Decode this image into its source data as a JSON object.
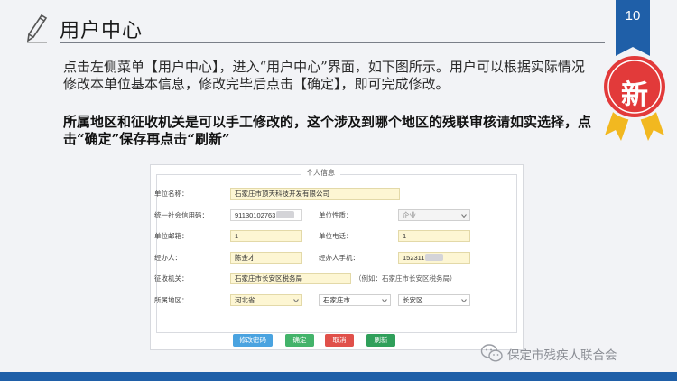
{
  "slide": {
    "title": "用户中心",
    "page_number": "10",
    "badge": "新"
  },
  "instructions": {
    "para1": "点击左侧菜单【用户中心】，进入“用户中心”界面，如下图所示。用户可以根据实际情况修改本单位基本信息，修改完毕后点击【确定】，即可完成修改。",
    "para2": "所属地区和征收机关是可以手工修改的，这个涉及到哪个地区的残联审核请如实选择，点击“确定”保存再点击“刷新”"
  },
  "form": {
    "legend": "个人信息",
    "fields": {
      "unit_name_label": "单位名称：",
      "unit_name_value": "石家庄市顶天科技开发有限公司",
      "credit_code_label": "统一社会信用码：",
      "credit_code_value": "91130102763",
      "unit_nature_label": "单位性质：",
      "unit_nature_value": "企业",
      "postcode_label": "单位邮箱：",
      "postcode_value": "1",
      "unit_phone_label": "单位电话：",
      "unit_phone_value": "1",
      "handler_label": "经办人：",
      "handler_value": "陈金才",
      "handler_mobile_label": "经办人手机：",
      "handler_mobile_value": "152311",
      "tax_office_label": "征收机关：",
      "tax_office_value": "石家庄市长安区税务局",
      "tax_office_hint": "（例如：石家庄市长安区税务局）",
      "region_label": "所属地区：",
      "province_value": "河北省",
      "city_value": "石家庄市",
      "district_value": "长安区"
    },
    "buttons": {
      "change_password": "修改密码",
      "confirm": "确定",
      "cancel": "取消",
      "refresh": "刷新"
    }
  },
  "watermark": "保定市残疾人联合会",
  "colors": {
    "brand_blue": "#1f5fa8",
    "badge_red": "#e23a3a",
    "badge_gold": "#f2b820",
    "input_yellow": "#fdf6d3"
  },
  "icons": [
    "pencil-icon",
    "chevron-down-icon",
    "wechat-icon"
  ]
}
